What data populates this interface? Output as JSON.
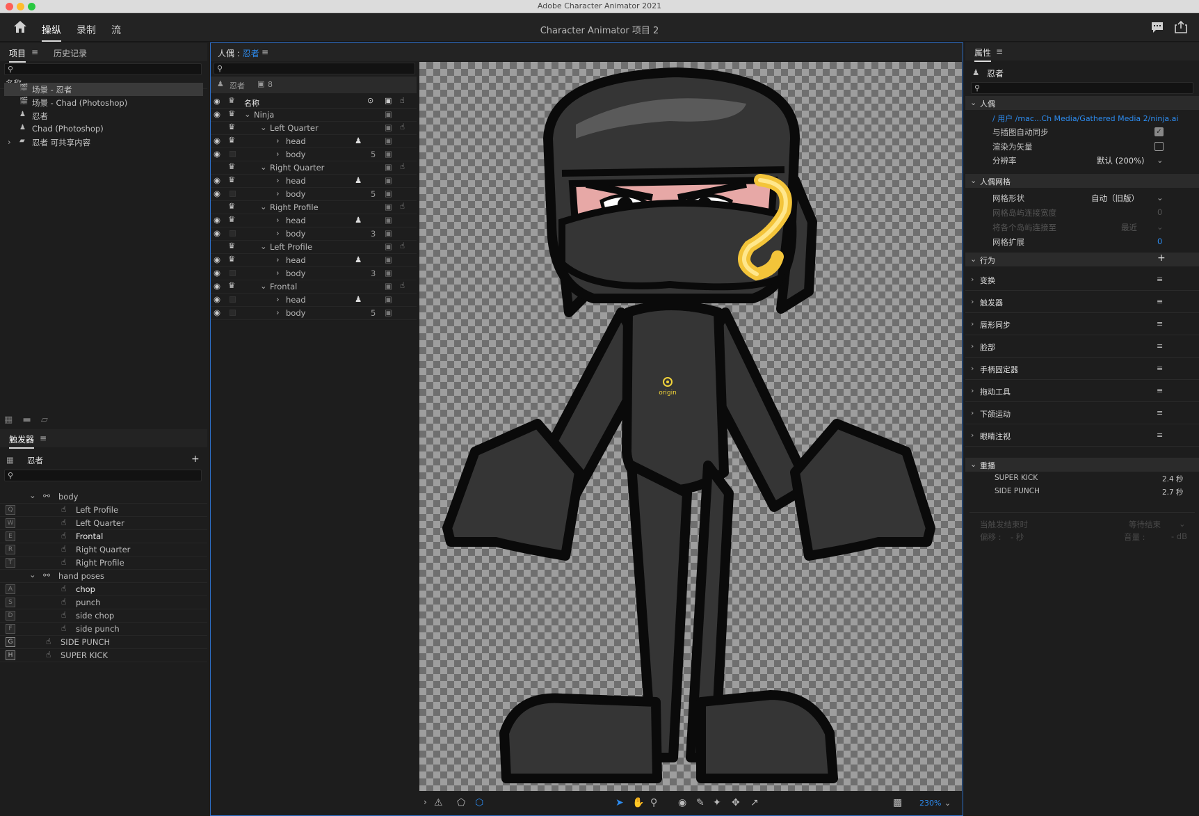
{
  "app_title": "Adobe Character Animator 2021",
  "project_title": "Character Animator 项目 2",
  "workspace_tabs": [
    "操纵",
    "录制",
    "流"
  ],
  "colors": {
    "accent": "#2d8cf0",
    "panel_bg": "#1d1d1d",
    "header_bg": "#232323",
    "mac_red": "#fe5f57",
    "mac_yellow": "#febc2e",
    "mac_green": "#28c840"
  },
  "project_panel": {
    "tabs": [
      "项目",
      "历史记录"
    ],
    "column_header": "名称",
    "items": [
      {
        "icon": "scene-icon",
        "label": "场景 - 忍者",
        "selected": true
      },
      {
        "icon": "scene-icon",
        "label": "场景 - Chad (Photoshop)"
      },
      {
        "icon": "puppet-icon",
        "label": "忍者"
      },
      {
        "icon": "puppet-icon",
        "label": "Chad (Photoshop)"
      },
      {
        "icon": "folder-icon",
        "label": "忍者 可共享内容"
      }
    ]
  },
  "triggers_panel": {
    "title": "触发器",
    "puppet_name": "忍者",
    "rows": [
      {
        "key": "",
        "indent": 1,
        "expand": "⌄",
        "icon": "swap-set-icon",
        "label": "body"
      },
      {
        "key": "Q",
        "indent": 2,
        "icon": "hand-trigger-icon",
        "label": "Left Profile"
      },
      {
        "key": "W",
        "indent": 2,
        "icon": "hand-trigger-icon",
        "label": "Left Quarter"
      },
      {
        "key": "E",
        "indent": 2,
        "icon": "hand-trigger-icon",
        "label": "Frontal",
        "bright": true
      },
      {
        "key": "R",
        "indent": 2,
        "icon": "hand-trigger-icon",
        "label": "Right Quarter"
      },
      {
        "key": "T",
        "indent": 2,
        "icon": "hand-trigger-icon",
        "label": "Right Profile"
      },
      {
        "key": "",
        "indent": 1,
        "expand": "⌄",
        "icon": "swap-set-icon",
        "label": "hand poses"
      },
      {
        "key": "A",
        "indent": 2,
        "icon": "hand-trigger-icon",
        "label": "chop",
        "bright": true
      },
      {
        "key": "S",
        "indent": 2,
        "icon": "hand-trigger-icon",
        "label": "punch"
      },
      {
        "key": "D",
        "indent": 2,
        "icon": "hand-trigger-icon",
        "label": "side chop"
      },
      {
        "key": "F",
        "indent": 2,
        "icon": "hand-trigger-icon",
        "label": "side punch"
      },
      {
        "key": "G",
        "indent": 1,
        "icon": "hand-trigger-icon",
        "label": "SIDE PUNCH",
        "filled": true
      },
      {
        "key": "H",
        "indent": 1,
        "icon": "hand-trigger-icon",
        "label": "SUPER KICK",
        "filled": true
      }
    ]
  },
  "puppet_panel": {
    "title_prefix": "人偶 : ",
    "title_name": "忍者",
    "header_name": "忍者",
    "header_count": "8",
    "column_name": "名称",
    "layers": [
      {
        "level": 0,
        "label": "Ninja",
        "expand": "⌄",
        "eye": true,
        "crown": true
      },
      {
        "level": 1,
        "label": "Left Quarter",
        "expand": "⌄",
        "eye": false,
        "crown": true,
        "hand": true
      },
      {
        "level": 2,
        "label": "head",
        "expand": "›",
        "eye": true,
        "crown": true,
        "puppet": true
      },
      {
        "level": 2,
        "label": "body",
        "expand": "›",
        "eye": true,
        "crown": false,
        "count": "5"
      },
      {
        "level": 1,
        "label": "Right Quarter",
        "expand": "⌄",
        "eye": false,
        "crown": true,
        "hand": true
      },
      {
        "level": 2,
        "label": "head",
        "expand": "›",
        "eye": true,
        "crown": true,
        "puppet": true
      },
      {
        "level": 2,
        "label": "body",
        "expand": "›",
        "eye": true,
        "crown": false,
        "count": "5"
      },
      {
        "level": 1,
        "label": "Right Profile",
        "expand": "⌄",
        "eye": false,
        "crown": true,
        "hand": true
      },
      {
        "level": 2,
        "label": "head",
        "expand": "›",
        "eye": true,
        "crown": true,
        "puppet": true
      },
      {
        "level": 2,
        "label": "body",
        "expand": "›",
        "eye": true,
        "crown": false,
        "count": "3"
      },
      {
        "level": 1,
        "label": "Left Profile",
        "expand": "⌄",
        "eye": false,
        "crown": true,
        "hand": true
      },
      {
        "level": 2,
        "label": "head",
        "expand": "›",
        "eye": true,
        "crown": true,
        "puppet": true
      },
      {
        "level": 2,
        "label": "body",
        "expand": "›",
        "eye": true,
        "crown": false,
        "count": "3"
      },
      {
        "level": 1,
        "label": "Frontal",
        "expand": "⌄",
        "eye": true,
        "crown": true,
        "hand": true
      },
      {
        "level": 2,
        "label": "head",
        "expand": "›",
        "eye": true,
        "crown": false,
        "puppet": true
      },
      {
        "level": 2,
        "label": "body",
        "expand": "›",
        "eye": true,
        "crown": false,
        "count": "5"
      }
    ],
    "origin_label": "origin",
    "zoom": "230%"
  },
  "properties_panel": {
    "title": "属性",
    "puppet_name": "忍者",
    "section_puppet": "人偶",
    "path": "/ 用户 /mac...Ch Media/Gathered Media 2/ninja.ai",
    "sync_label": "与插图自动同步",
    "vector_label": "渲染为矢量",
    "resolution_label": "分辨率",
    "resolution_value": "默认 (200%)",
    "section_mesh": "人偶网格",
    "mesh_shape_label": "网格形状",
    "mesh_shape_value": "自动（旧版）",
    "island_width_label": "网格岛屿连接宽度",
    "island_width_value": "0",
    "connect_islands_label": "将各个岛屿连接至",
    "connect_islands_value": "最近",
    "mesh_expand_label": "网格扩展",
    "mesh_expand_value": "0",
    "section_behaviors": "行为",
    "behaviors": [
      "变换",
      "触发器",
      "唇形同步",
      "脸部",
      "手柄固定器",
      "拖动工具",
      "下颌运动",
      "眼睛注视"
    ],
    "section_replays": "重播",
    "replays": [
      {
        "name": "SUPER KICK",
        "duration": "2.4 秒"
      },
      {
        "name": "SIDE PUNCH",
        "duration": "2.7 秒"
      }
    ],
    "trigger_end_label": "当触发结束时",
    "trigger_end_value": "等待结束",
    "offset_label": "偏移 :",
    "offset_value": "- 秒",
    "volume_label": "音量 :",
    "volume_value": "- dB"
  }
}
